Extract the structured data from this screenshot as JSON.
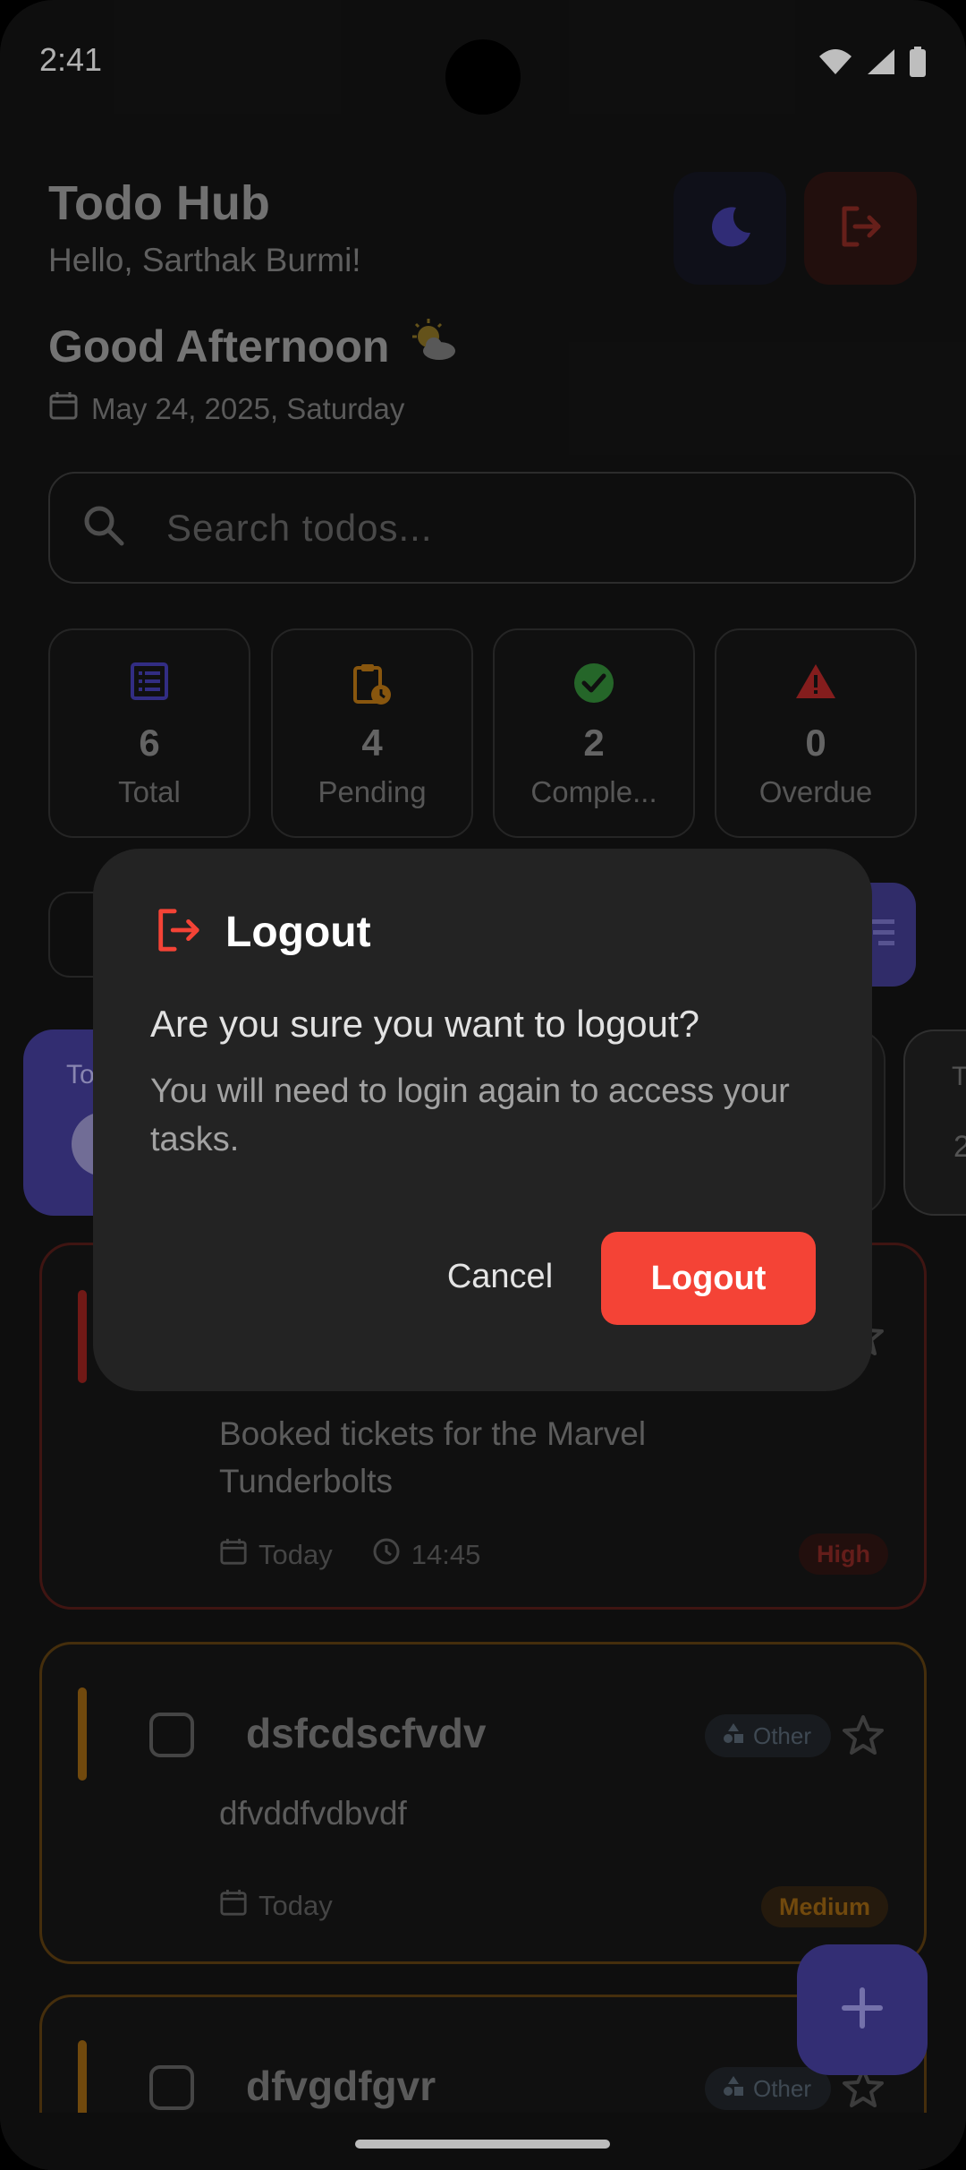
{
  "status_bar": {
    "time": "2:41"
  },
  "header": {
    "app_title": "Todo Hub",
    "user_greeting": "Hello, Sarthak Burmi!",
    "greeting": "Good Afternoon",
    "greeting_emoji": "🌤️",
    "date": "May 24, 2025, Saturday",
    "theme_icon": "moon-icon",
    "logout_icon": "logout-icon"
  },
  "search": {
    "placeholder": "Search todos..."
  },
  "stats": [
    {
      "value": "6",
      "label": "Total",
      "icon": "list-icon",
      "color": "#3d37a0"
    },
    {
      "value": "4",
      "label": "Pending",
      "icon": "clipboard-clock-icon",
      "color": "#a66a12"
    },
    {
      "value": "2",
      "label": "Comple...",
      "icon": "check-circle-icon",
      "color": "#2e7d32"
    },
    {
      "value": "0",
      "label": "Overdue",
      "icon": "warning-icon",
      "color": "#a12424"
    }
  ],
  "tabs": [
    {
      "label": "To"
    },
    {
      "label": "T",
      "count": "2"
    }
  ],
  "todos": [
    {
      "description": "Booked tickets for the Marvel Tunderbolts",
      "date": "Today",
      "time": "14:45",
      "priority": "High",
      "accent_color": "#8a1f1b"
    },
    {
      "title": "dsfcdscfvdv",
      "category": "Other",
      "description": "dfvddfvdbvdf",
      "date": "Today",
      "priority": "Medium",
      "accent_color": "#8a5a10"
    },
    {
      "title": "dfvgdfgvr",
      "category": "Other",
      "accent_color": "#8a5a10"
    }
  ],
  "dialog": {
    "title": "Logout",
    "question": "Are you sure you want to logout?",
    "description": "You will need to login again to access your tasks.",
    "cancel_label": "Cancel",
    "confirm_label": "Logout",
    "accent": "#f44336"
  },
  "colors": {
    "brand": "#3f398e",
    "danger": "#f44336",
    "background": "#121212"
  }
}
